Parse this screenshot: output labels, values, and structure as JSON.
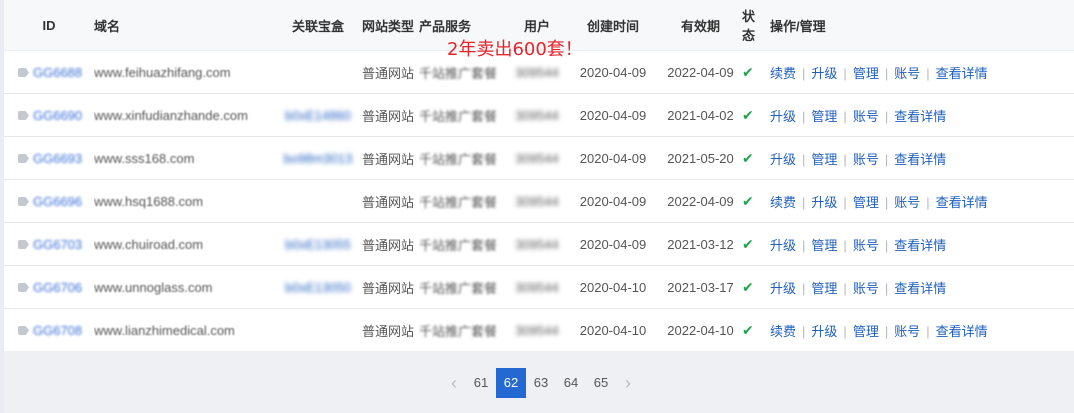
{
  "promo_text": "2年卖出600套！",
  "headers": {
    "id": "ID",
    "domain": "域名",
    "box": "关联宝盒",
    "site_type": "网站类型",
    "product": "产品服务",
    "user": "用户",
    "created": "创建时间",
    "expire": "有效期",
    "status": "状态",
    "ops": "操作/管理"
  },
  "rows": [
    {
      "id": "GG6688",
      "domain": "www.feihuazhifang.com",
      "box": "",
      "site_type": "普通网站",
      "product": "千站推广套餐",
      "user": "309544",
      "created": "2020-04-09",
      "expire": "2022-04-09",
      "renew": "续费"
    },
    {
      "id": "GG6690",
      "domain": "www.xinfudianzhande.com",
      "box": "b0xE14860",
      "site_type": "普通网站",
      "product": "千站推广套餐",
      "user": "309544",
      "created": "2020-04-09",
      "expire": "2021-04-02",
      "renew": ""
    },
    {
      "id": "GG6693",
      "domain": "www.sss168.com",
      "box": "bo98m3013",
      "site_type": "普通网站",
      "product": "千站推广套餐",
      "user": "309544",
      "created": "2020-04-09",
      "expire": "2021-05-20",
      "renew": ""
    },
    {
      "id": "GG6696",
      "domain": "www.hsq1688.com",
      "box": "",
      "site_type": "普通网站",
      "product": "千站推广套餐",
      "user": "309544",
      "created": "2020-04-09",
      "expire": "2022-04-09",
      "renew": "续费"
    },
    {
      "id": "GG6703",
      "domain": "www.chuiroad.com",
      "box": "b0xE13055",
      "site_type": "普通网站",
      "product": "千站推广套餐",
      "user": "309544",
      "created": "2020-04-09",
      "expire": "2021-03-12",
      "renew": ""
    },
    {
      "id": "GG6706",
      "domain": "www.unnoglass.com",
      "box": "b0xE13050",
      "site_type": "普通网站",
      "product": "千站推广套餐",
      "user": "309544",
      "created": "2020-04-10",
      "expire": "2021-03-17",
      "renew": ""
    },
    {
      "id": "GG6708",
      "domain": "www.lianzhimedical.com",
      "box": "",
      "site_type": "普通网站",
      "product": "千站推广套餐",
      "user": "309544",
      "created": "2020-04-10",
      "expire": "2022-04-10",
      "renew": "续费"
    }
  ],
  "ops_labels": {
    "renew": "续费",
    "upgrade": "升级",
    "manage": "管理",
    "account": "账号",
    "details": "查看详情"
  },
  "status_icon": "check-icon",
  "colors": {
    "accent": "#2469d1",
    "link": "#1f5fbf",
    "check": "#21a34f",
    "promo": "#e8242b"
  },
  "pager": {
    "prev": "‹",
    "next": "›",
    "pages": [
      "61",
      "62",
      "63",
      "64",
      "65"
    ],
    "current": "62"
  }
}
